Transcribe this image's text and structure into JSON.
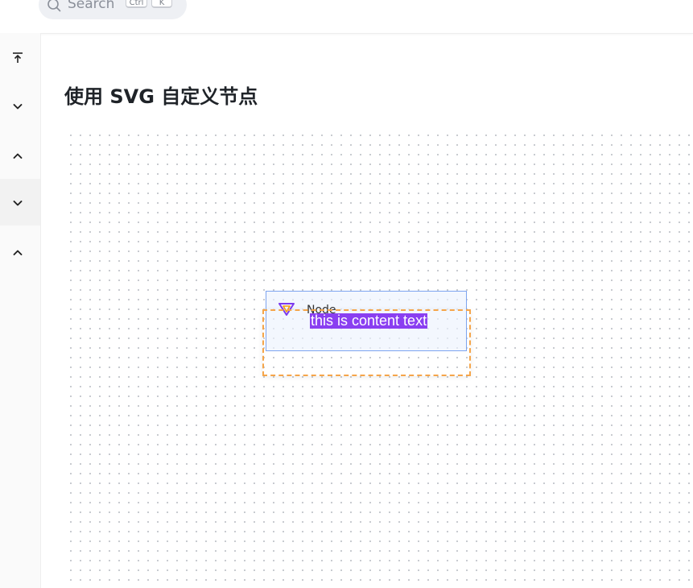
{
  "header": {
    "search": {
      "placeholder": "Search",
      "shortcut_modifier": "Ctrl",
      "shortcut_key": "K"
    }
  },
  "sidebar": {
    "buttons": [
      {
        "icon": "arrow-up-to-top-icon"
      },
      {
        "icon": "chevron-down-icon"
      },
      {
        "icon": "chevron-up-icon"
      },
      {
        "icon": "chevron-down-icon"
      },
      {
        "icon": "chevron-up-icon"
      }
    ]
  },
  "main": {
    "title": "使用 SVG 自定义节点"
  },
  "canvas": {
    "node": {
      "title": "Node",
      "content_text": "this is content text",
      "border_color": "#7da4f0",
      "selection_color": "#f5a54a",
      "text_highlight_color": "#8a3ff1"
    }
  }
}
